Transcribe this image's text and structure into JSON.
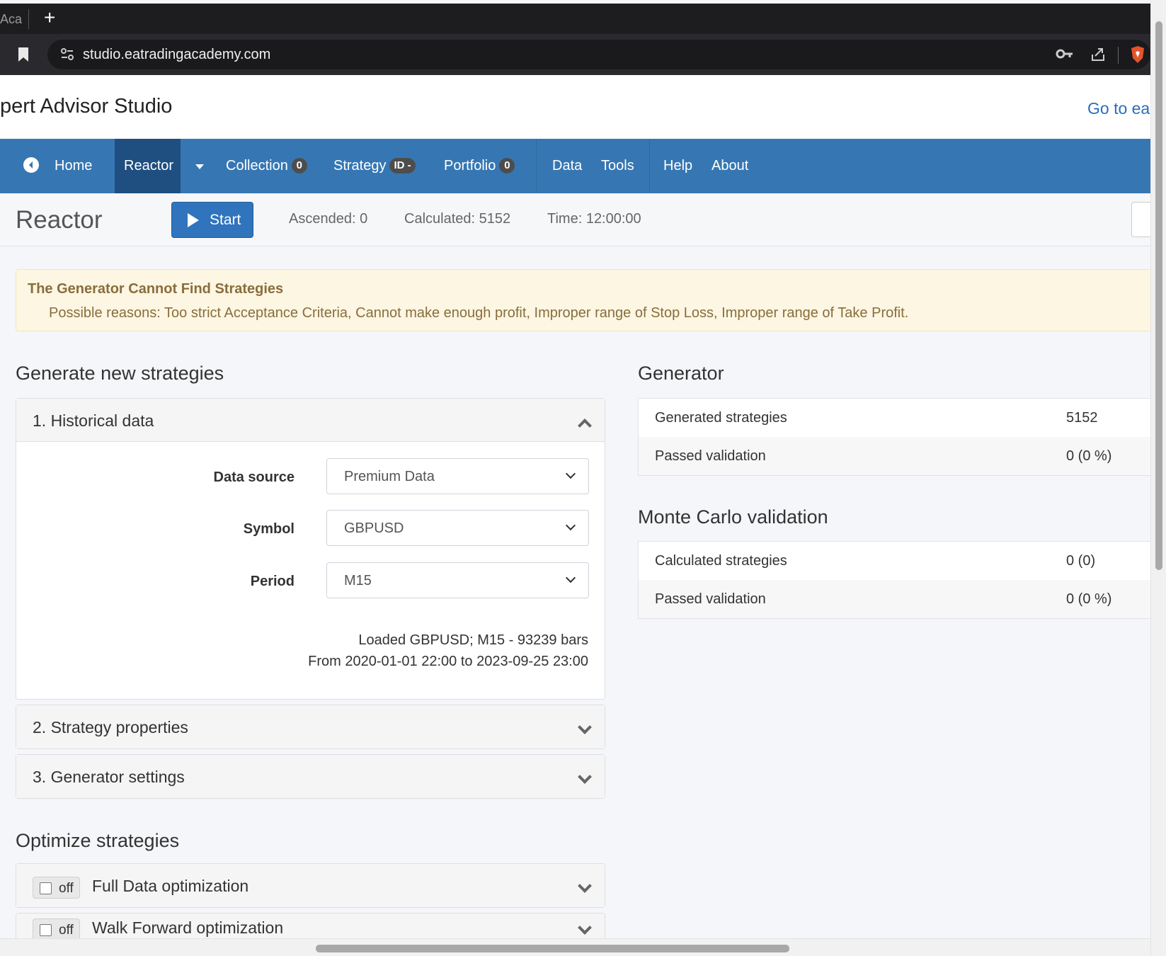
{
  "browser": {
    "tab_label": "Aca",
    "new_tab_symbol": "+",
    "url": "studio.eatradingacademy.com",
    "icons": [
      "bookmark-icon",
      "site-settings-icon",
      "key-icon",
      "share-icon",
      "brave-shield-icon"
    ]
  },
  "app": {
    "title": "pert Advisor Studio",
    "goto_link": "Go to ea"
  },
  "nav": {
    "home": "Home",
    "reactor": "Reactor",
    "collection": "Collection",
    "collection_count": "0",
    "strategy": "Strategy",
    "strategy_id": "ID -",
    "portfolio": "Portfolio",
    "portfolio_count": "0",
    "data": "Data",
    "tools": "Tools",
    "help": "Help",
    "about": "About"
  },
  "toolbar": {
    "title": "Reactor",
    "start_label": "Start",
    "ascended": "Ascended: 0",
    "calculated": "Calculated: 5152",
    "time": "Time: 12:00:00"
  },
  "alert": {
    "title": "The Generator Cannot Find Strategies",
    "text": "Possible reasons: Too strict Acceptance Criteria, Cannot make enough profit, Improper range of Stop Loss, Improper range of Take Profit."
  },
  "generate": {
    "heading": "Generate new strategies",
    "historical": {
      "title": "1. Historical data",
      "data_source_label": "Data source",
      "data_source_value": "Premium Data",
      "symbol_label": "Symbol",
      "symbol_value": "GBPUSD",
      "period_label": "Period",
      "period_value": "M15",
      "loaded_line1": "Loaded GBPUSD; M15 - 93239 bars",
      "loaded_line2": "From 2020-01-01 22:00 to 2023-09-25 23:00"
    },
    "strategy_properties": "2. Strategy properties",
    "generator_settings": "3. Generator settings"
  },
  "optimize": {
    "heading": "Optimize strategies",
    "off_label": "off",
    "full_data": "Full Data optimization",
    "walk_forward": "Walk Forward optimization"
  },
  "generator": {
    "heading": "Generator",
    "rows": [
      {
        "label": "Generated strategies",
        "value": "5152"
      },
      {
        "label": "Passed validation",
        "value": "0 (0 %)"
      }
    ]
  },
  "montecarlo": {
    "heading": "Monte Carlo validation",
    "rows": [
      {
        "label": "Calculated strategies",
        "value": "0 (0)"
      },
      {
        "label": "Passed validation",
        "value": "0 (0 %)"
      }
    ]
  }
}
